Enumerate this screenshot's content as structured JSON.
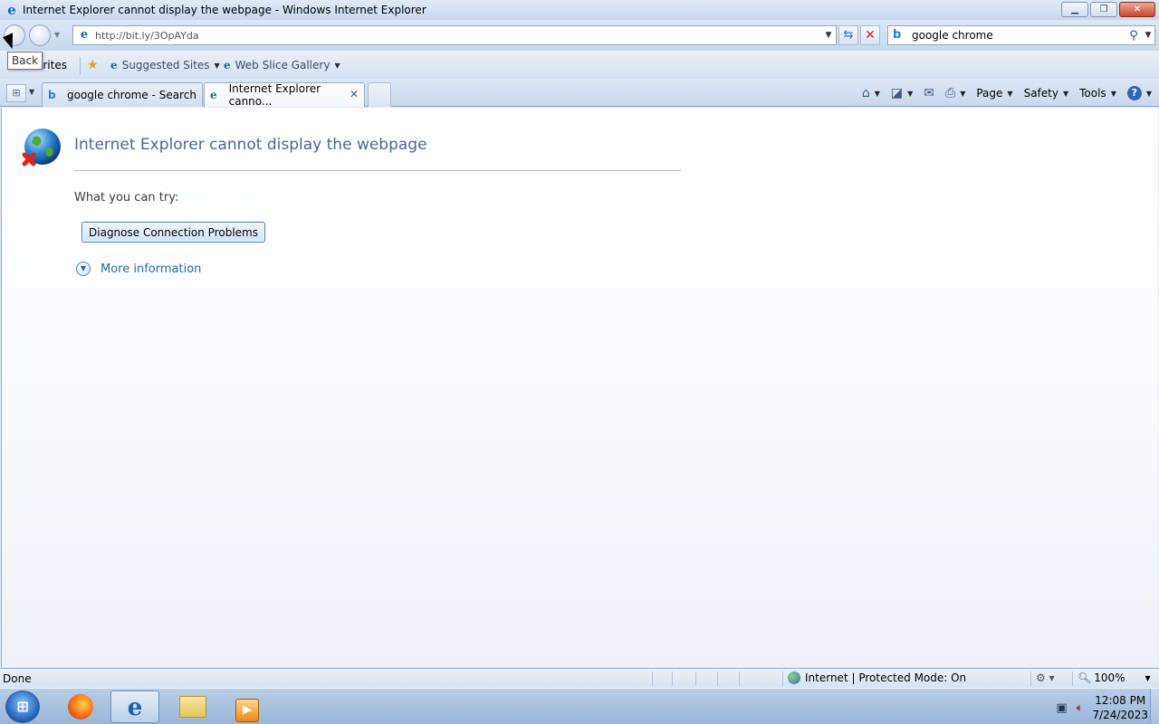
{
  "window": {
    "title": "Internet Explorer cannot display the webpage - Windows Internet Explorer",
    "min_glyph": "▁",
    "restore_glyph": "❐",
    "close_glyph": "✕"
  },
  "nav": {
    "address_url": "http://bit.ly/3OpAYda",
    "search_query": "google chrome",
    "dropdown_glyph": "▼",
    "refresh_glyph": "⇆",
    "stop_glyph": "✕",
    "search_glyph": "⚲"
  },
  "favorites": {
    "label": "orites",
    "items": [
      {
        "label": "Suggested Sites"
      },
      {
        "label": "Web Slice Gallery"
      }
    ]
  },
  "tooltip": {
    "text": "Back"
  },
  "tabs": [
    {
      "label": "google chrome - Search",
      "active": false
    },
    {
      "label": "Internet Explorer canno...",
      "active": true
    }
  ],
  "commandbar": {
    "home_glyph": "⌂",
    "feeds_glyph": "◪",
    "mail_glyph": "✉",
    "print_glyph": "⎙",
    "help_glyph": "?",
    "page_label": "Page",
    "safety_label": "Safety",
    "tools_label": "Tools"
  },
  "error_page": {
    "title": "Internet Explorer cannot display the webpage",
    "try_label": "What you can try:",
    "diagnose_button": "Diagnose Connection Problems",
    "more_info": "More information"
  },
  "statusbar": {
    "status": "Done",
    "zone": "Internet | Protected Mode: On",
    "zoom": "100%"
  },
  "taskbar": {
    "time": "12:08 PM",
    "date": "7/24/2023"
  },
  "colors": {
    "link": "#2a6aa8",
    "title_text": "#4a6792",
    "error_red": "#d9201a"
  }
}
